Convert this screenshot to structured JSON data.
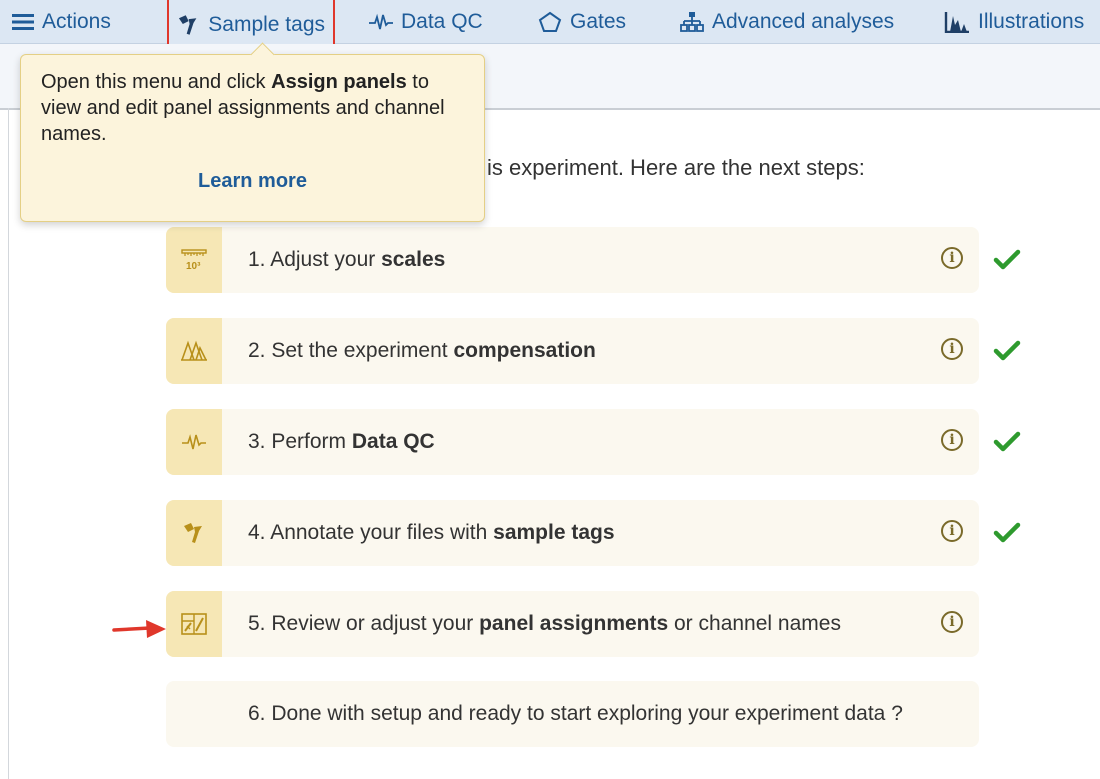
{
  "nav": {
    "items": [
      {
        "label": "Actions",
        "icon": "hamburger-icon"
      },
      {
        "label": "Sample tags",
        "icon": "tag-icon"
      },
      {
        "label": "Data QC",
        "icon": "pulse-icon"
      },
      {
        "label": "Gates",
        "icon": "pentagon-icon"
      },
      {
        "label": "Advanced analyses",
        "icon": "hierarchy-icon"
      },
      {
        "label": "Illustrations",
        "icon": "histogram-icon"
      }
    ],
    "highlighted": "Sample tags"
  },
  "tooltip": {
    "text_before": "Open this menu and click ",
    "text_bold": "Assign panels",
    "text_after": " to view and edit panel assignments and channel names.",
    "link": "Learn more"
  },
  "intro_visible": "is experiment. Here are the next steps:",
  "steps": [
    {
      "prefix": "1. Adjust your ",
      "bold": "scales",
      "suffix": "",
      "icon": "ruler-icon",
      "done": true,
      "has_info": true
    },
    {
      "prefix": "2. Set the experiment ",
      "bold": "compensation",
      "suffix": "",
      "icon": "compensation-icon",
      "done": true,
      "has_info": true
    },
    {
      "prefix": "3. Perform ",
      "bold": "Data QC",
      "suffix": "",
      "icon": "pulse-icon",
      "done": true,
      "has_info": true
    },
    {
      "prefix": "4. Annotate your files with ",
      "bold": "sample tags",
      "suffix": "",
      "icon": "tag-icon",
      "done": true,
      "has_info": true
    },
    {
      "prefix": "5. Review or adjust your ",
      "bold": "panel assignments",
      "suffix": " or channel names",
      "icon": "panel-icon",
      "done": false,
      "has_info": true
    },
    {
      "prefix": "6. Done with setup and ready to start exploring your experiment data ?",
      "bold": "",
      "suffix": "",
      "icon": "",
      "done": false,
      "has_info": false
    }
  ],
  "colors": {
    "nav_bg": "#dce7f3",
    "nav_text": "#1f5c99",
    "tooltip_bg": "#fcf4dc",
    "step_bg": "#fbf8ef",
    "step_icon_bg": "#f6e7b5",
    "icon_gold": "#b8901a",
    "check_green": "#2e9a2e",
    "highlight_red": "#e0372b"
  }
}
